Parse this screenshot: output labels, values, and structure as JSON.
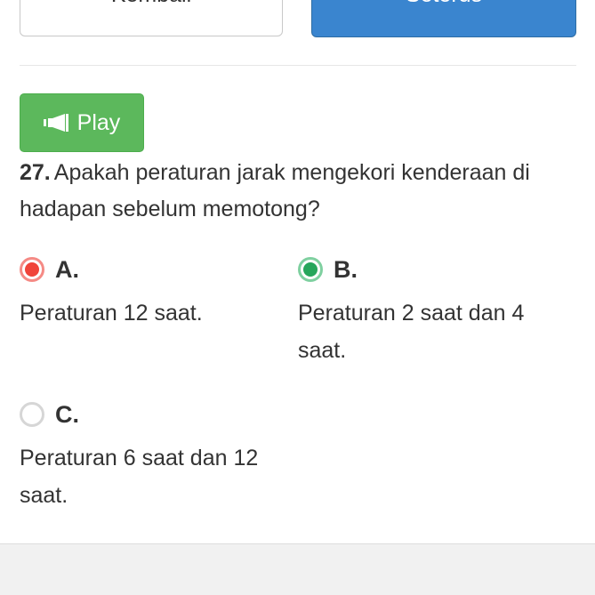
{
  "nav": {
    "back_label": "Kembali",
    "next_label": "Seterus"
  },
  "play": {
    "label": "Play",
    "icon": "bullhorn-icon"
  },
  "question": {
    "number": "27.",
    "text": "Apakah peraturan jarak mengekori kenderaan di hadapan sebelum memotong?"
  },
  "options": [
    {
      "letter": "A.",
      "text": "Peraturan 12 saat.",
      "state": "wrong-selected",
      "color": "#f0443a"
    },
    {
      "letter": "B.",
      "text": "Peraturan 2 saat dan 4 saat.",
      "state": "correct",
      "color": "#26a65b"
    },
    {
      "letter": "C.",
      "text": "Peraturan 6 saat dan 12 saat.",
      "state": "unselected",
      "color": "#d6d6d6"
    }
  ],
  "colors": {
    "play_button": "#5cb85c",
    "next_button": "#3a85cf"
  }
}
